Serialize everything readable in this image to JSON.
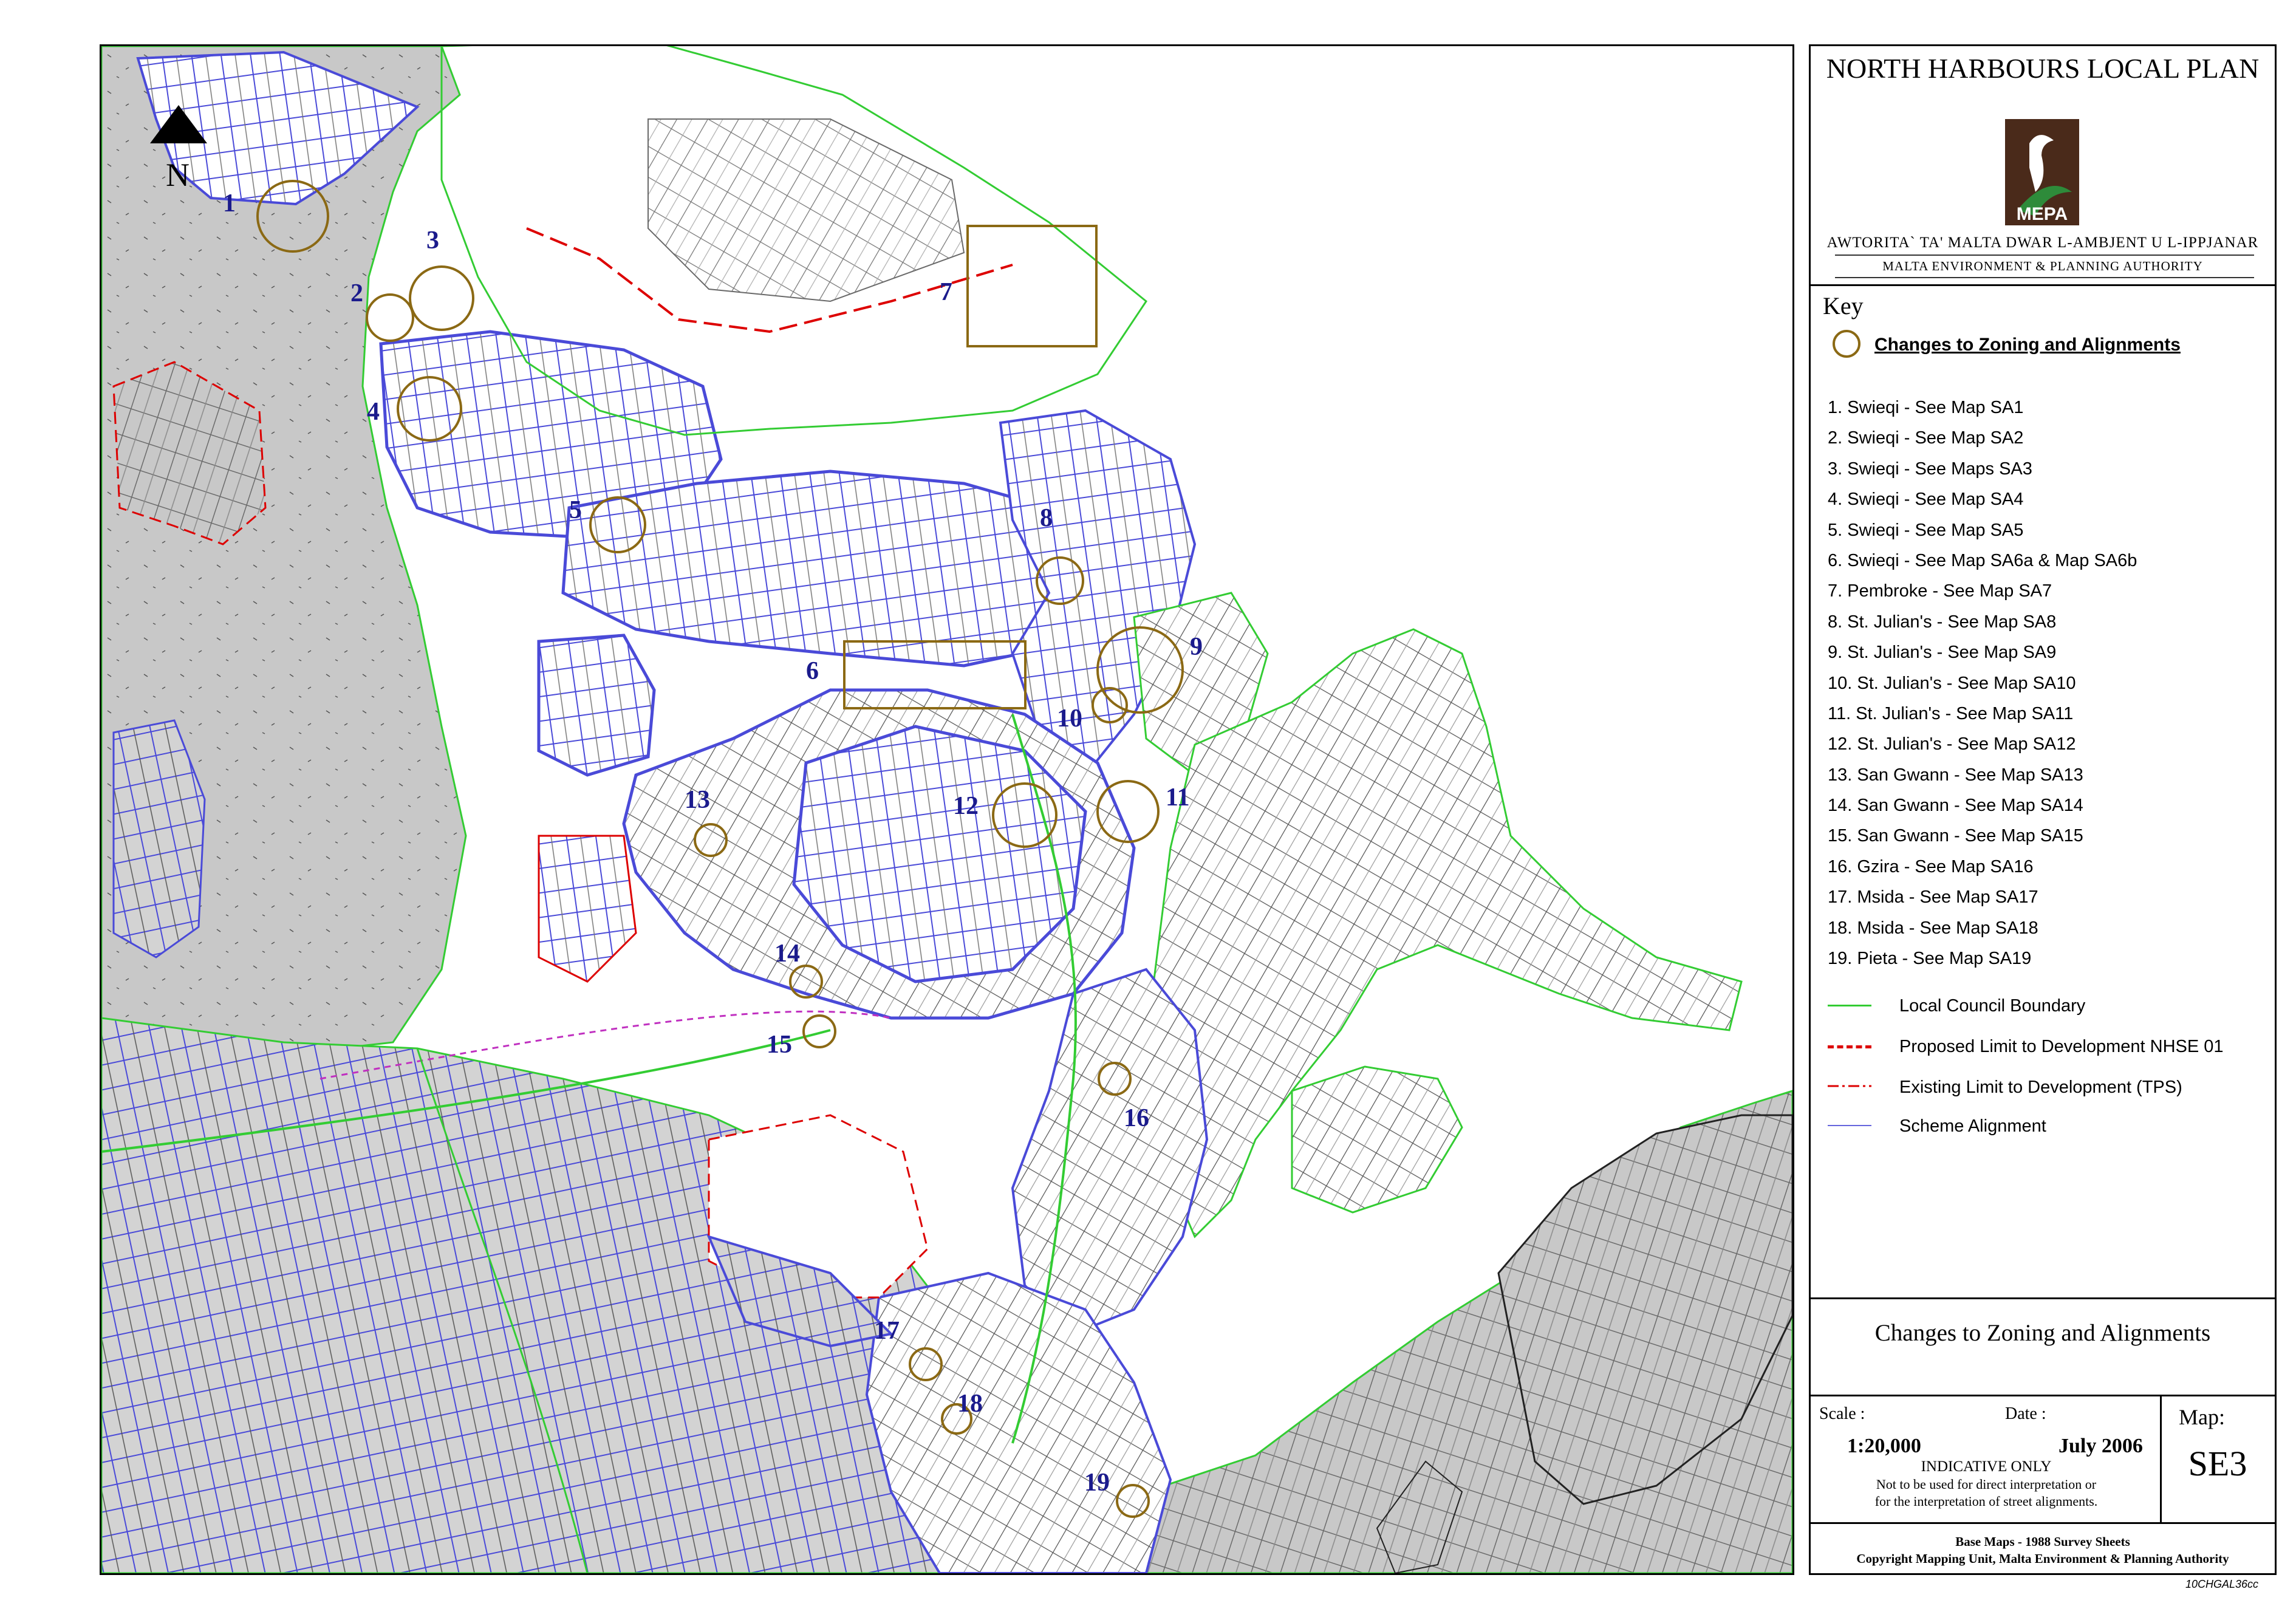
{
  "panel": {
    "title": "NORTH HARBOURS LOCAL PLAN",
    "logo_text": "MEPA",
    "authority_mt": "AWTORITA` TA' MALTA DWAR L-AMBJENT U L-IPPJANAR",
    "authority_en": "MALTA ENVIRONMENT & PLANNING AUTHORITY",
    "key_title": "Key",
    "key_heading": "Changes to Zoning and Alignments",
    "areas": [
      "1. Swieqi - See Map SA1",
      "2. Swieqi - See Map SA2",
      "3. Swieqi - See Maps SA3",
      "4. Swieqi - See Map SA4",
      "5. Swieqi - See Map SA5",
      "6. Swieqi - See Map SA6a & Map SA6b",
      "7. Pembroke - See Map SA7",
      "8. St. Julian's - See Map SA8",
      "9. St. Julian's - See Map SA9",
      "10. St. Julian's - See Map SA10",
      "11. St. Julian's - See Map SA11",
      "12. St. Julian's - See Map SA12",
      "13. San Gwann - See Map SA13",
      "14. San Gwann - See Map SA14",
      "15. San Gwann - See Map SA15",
      "16. Gzira - See Map SA16",
      "17. Msida - See Map SA17",
      "18. Msida - See Map SA18",
      "19. Pieta - See Map SA19"
    ],
    "legend": [
      {
        "label": "Local Council Boundary",
        "color": "#33cc33",
        "style": "solid"
      },
      {
        "label": "Proposed Limit to Development NHSE 01",
        "color": "#dd0000",
        "style": "long-dash"
      },
      {
        "label": "Existing Limit to Development (TPS)",
        "color": "#dd0000",
        "style": "dash-dot"
      },
      {
        "label": "Scheme Alignment",
        "color": "#6666dd",
        "style": "solid"
      }
    ],
    "sheet_title": "Changes to Zoning and Alignments",
    "scale_label": "Scale :",
    "scale_value": "1:20,000",
    "date_label": "Date :",
    "date_value": "July 2006",
    "map_label": "Map:",
    "map_value": "SE3",
    "indicative": "INDICATIVE ONLY",
    "disclaimer_1": "Not to be used for direct interpretation or",
    "disclaimer_2": "for the interpretation of street alignments.",
    "basemaps": "Base Maps - 1988 Survey Sheets",
    "copyright": "Copyright Mapping Unit, Malta Environment & Planning Authority"
  },
  "map": {
    "north_label": "N",
    "area_numbers": [
      "1",
      "2",
      "3",
      "4",
      "5",
      "6",
      "7",
      "8",
      "9",
      "10",
      "11",
      "12",
      "13",
      "14",
      "15",
      "16",
      "17",
      "18",
      "19"
    ],
    "colors": {
      "built_up_grey": "#c8c8c8",
      "scheme_alignment": "#4a4ad8",
      "council_boundary": "#33cc33",
      "limit_to_development": "#dd0000",
      "change_marker": "#8b6914",
      "label": "#1b1b8c"
    }
  },
  "drawing_ref": "10CHGAL36cc"
}
